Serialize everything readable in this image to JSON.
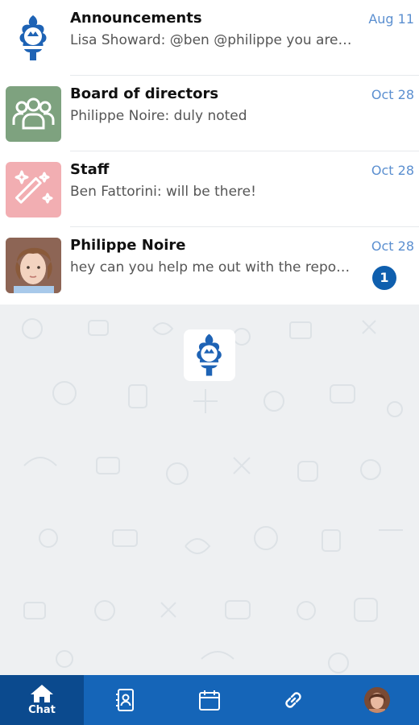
{
  "chats": [
    {
      "name": "Announcements",
      "preview": "Lisa Showard: @ben @philippe you are …",
      "date": "Aug 11",
      "avatar": "org-logo-icon"
    },
    {
      "name": "Board of directors",
      "preview": "Philippe Noire: duly noted",
      "date": "Oct 28",
      "avatar": "group-icon",
      "avatar_color": "#7ea27f"
    },
    {
      "name": "Staff",
      "preview": "Ben Fattorini: will be there!",
      "date": "Oct 28",
      "avatar": "magic-wand-icon",
      "avatar_color": "#f2aeb2"
    },
    {
      "name": "Philippe Noire",
      "preview": "hey can you help me out with the repo…",
      "date": "Oct 28",
      "avatar": "user-photo",
      "unread": "1"
    }
  ],
  "tabs": [
    {
      "label": "Chat",
      "icon": "home-icon",
      "active": true
    },
    {
      "label": "",
      "icon": "contacts-icon"
    },
    {
      "label": "",
      "icon": "calendar-icon"
    },
    {
      "label": "",
      "icon": "link-icon"
    },
    {
      "label": "",
      "icon": "profile-avatar"
    }
  ],
  "colors": {
    "accent": "#1565b8",
    "active_tab": "#0b4a8e",
    "date": "#5b8fd0",
    "badge": "#0f5fae"
  }
}
